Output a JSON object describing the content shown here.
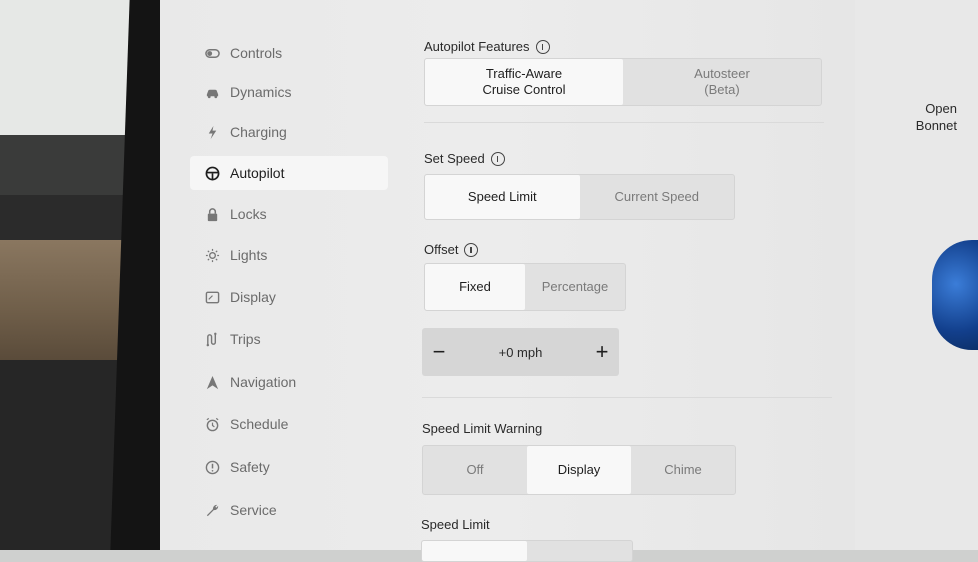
{
  "sidebar": {
    "items": [
      {
        "label": "Controls",
        "icon": "toggle-icon",
        "active": false
      },
      {
        "label": "Dynamics",
        "icon": "car-icon",
        "active": false
      },
      {
        "label": "Charging",
        "icon": "lightning-icon",
        "active": false
      },
      {
        "label": "Autopilot",
        "icon": "steering-wheel-icon",
        "active": true
      },
      {
        "label": "Locks",
        "icon": "lock-icon",
        "active": false
      },
      {
        "label": "Lights",
        "icon": "sun-icon",
        "active": false
      },
      {
        "label": "Display",
        "icon": "display-icon",
        "active": false
      },
      {
        "label": "Trips",
        "icon": "trips-icon",
        "active": false
      },
      {
        "label": "Navigation",
        "icon": "navigation-icon",
        "active": false
      },
      {
        "label": "Schedule",
        "icon": "alarm-clock-icon",
        "active": false
      },
      {
        "label": "Safety",
        "icon": "safety-icon",
        "active": false
      },
      {
        "label": "Service",
        "icon": "wrench-icon",
        "active": false
      }
    ]
  },
  "autopilot_features": {
    "label": "Autopilot Features",
    "options": [
      "Traffic-Aware\nCruise Control",
      "Autosteer\n(Beta)"
    ],
    "selected": 0
  },
  "set_speed": {
    "label": "Set Speed",
    "options": [
      "Speed Limit",
      "Current Speed"
    ],
    "selected": 0
  },
  "offset": {
    "label": "Offset",
    "options": [
      "Fixed",
      "Percentage"
    ],
    "selected": 0,
    "value": "+0 mph",
    "minus": "−",
    "plus": "+"
  },
  "speed_limit_warning": {
    "label": "Speed Limit Warning",
    "options": [
      "Off",
      "Display",
      "Chime"
    ],
    "selected": 1
  },
  "speed_limit": {
    "label": "Speed Limit"
  },
  "right_panel": {
    "open_bonnet_line1": "Open",
    "open_bonnet_line2": "Bonnet"
  }
}
